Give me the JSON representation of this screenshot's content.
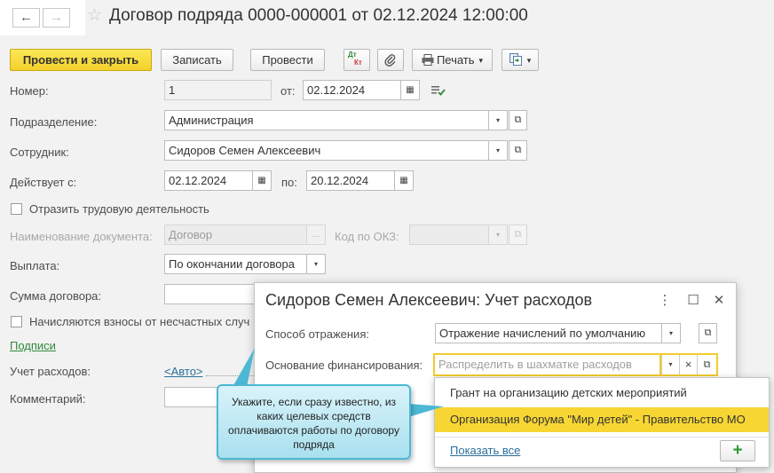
{
  "header": {
    "back_icon": "←",
    "forward_icon": "→",
    "star_icon": "☆",
    "title": "Договор подряда 0000-000001 от 02.12.2024 12:00:00"
  },
  "toolbar": {
    "post_close": "Провести и закрыть",
    "save": "Записать",
    "post": "Провести",
    "dtkt_top": "Дт",
    "dtkt_bottom": "Кт",
    "print": "Печать",
    "arrow_down": "▾"
  },
  "form": {
    "number_label": "Номер:",
    "number_value": "1",
    "from_label": "от:",
    "from_value": "02.12.2024",
    "department_label": "Подразделение:",
    "department_value": "Администрация",
    "employee_label": "Сотрудник:",
    "employee_value": "Сидоров Семен Алексеевич",
    "valid_from_label": "Действует с:",
    "valid_from_value": "02.12.2024",
    "valid_to_label": "по:",
    "valid_to_value": "20.12.2024",
    "labor_activity_label": "Отразить трудовую деятельность",
    "doc_name_label": "Наименование документа:",
    "doc_name_value": "Договор",
    "okz_label": "Код по ОКЗ:",
    "payment_label": "Выплата:",
    "payment_value": "По окончании договора",
    "contract_sum_label": "Сумма договора:",
    "accident_label": "Начисляются взносы от несчастных случ",
    "signatures_link": "Подписи",
    "expense_label": "Учет расходов:",
    "expense_link": "<Авто>",
    "comment_label": "Комментарий:"
  },
  "dialog": {
    "title": "Сидоров Семен Алексеевич: Учет расходов",
    "more_icon": "⋮",
    "maximize_icon": "☐",
    "close_icon": "✕",
    "method_label": "Способ отражения:",
    "method_value": "Отражение начислений по умолчанию",
    "funding_label": "Основание финансирования:",
    "funding_placeholder": "Распределить в шахматке расходов",
    "clear_icon": "×"
  },
  "dropdown": {
    "items": [
      "Грант на организацию детских мероприятий",
      "Организация Форума \"Мир детей\" - Правительство МО"
    ],
    "show_all": "Показать все",
    "add_icon": "+"
  },
  "tooltip": {
    "text": "Укажите, если сразу известно, из каких целевых средств оплачиваются работы по договору подряда"
  },
  "colors": {
    "primary": "#f4d02a",
    "link": "#2b6e99",
    "selected": "#f7d634",
    "tooltip_border": "#4cb8d3"
  }
}
